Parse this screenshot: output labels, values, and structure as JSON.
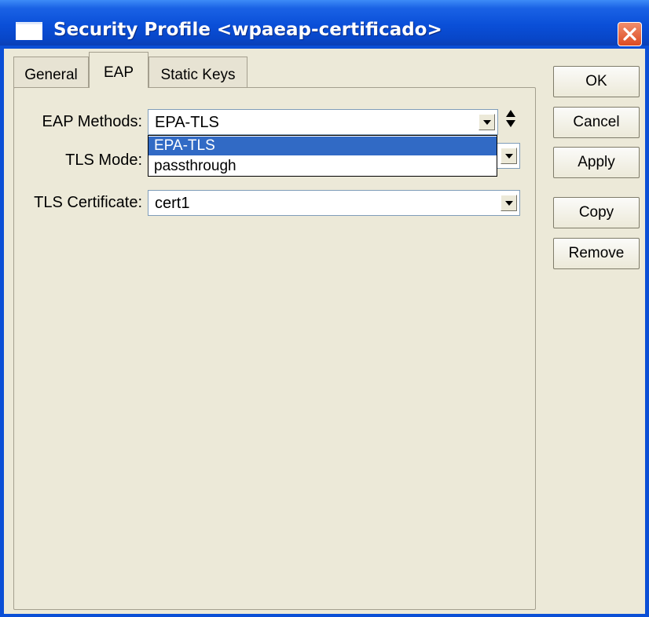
{
  "window": {
    "title": "Security Profile <wpaeap-certificado>"
  },
  "tabs": [
    {
      "label": "General",
      "active": false
    },
    {
      "label": "EAP",
      "active": true
    },
    {
      "label": "Static Keys",
      "active": false
    }
  ],
  "form": {
    "eap_methods": {
      "label": "EAP Methods:",
      "value": "EPA-TLS"
    },
    "tls_mode": {
      "label": "TLS Mode:",
      "value": ""
    },
    "tls_certificate": {
      "label": "TLS Certificate:",
      "value": "cert1"
    }
  },
  "dropdown": {
    "options": [
      {
        "label": "EPA-TLS",
        "selected": true
      },
      {
        "label": "passthrough",
        "selected": false
      }
    ]
  },
  "buttons": {
    "ok": "OK",
    "cancel": "Cancel",
    "apply": "Apply",
    "copy": "Copy",
    "remove": "Remove"
  },
  "colors": {
    "titlebar": "#0a4fd8",
    "selection": "#316ac5",
    "window_bg": "#ece9d8",
    "close_button": "#dd4b22"
  },
  "icons": [
    "window-icon",
    "close-icon",
    "dropdown-arrow-icon",
    "spinner-icon"
  ]
}
